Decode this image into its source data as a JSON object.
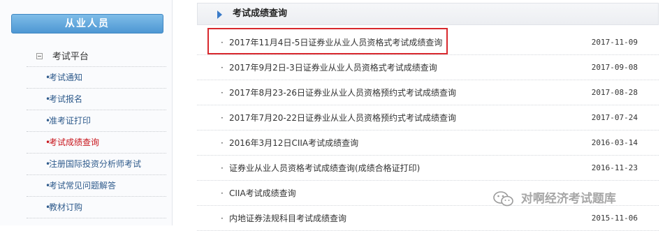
{
  "sidebar": {
    "header": "从业人员",
    "group_label": "考试平台",
    "items": [
      {
        "label": "考试通知",
        "active": false
      },
      {
        "label": "考试报名",
        "active": false
      },
      {
        "label": "准考证打印",
        "active": false
      },
      {
        "label": "考试成绩查询",
        "active": true
      },
      {
        "label": "注册国际投资分析师考试",
        "active": false
      },
      {
        "label": "考试常见问题解答",
        "active": false
      },
      {
        "label": "教材订购",
        "active": false
      }
    ]
  },
  "main": {
    "title": "考试成绩查询",
    "results": [
      {
        "title": "2017年11月4日-5日证券业从业人员资格式考试成绩查询",
        "date": "2017-11-09",
        "highlighted": true
      },
      {
        "title": "2017年9月2日-3日证券业从业人员资格式考试成绩查询",
        "date": "2017-09-08",
        "highlighted": false
      },
      {
        "title": "2017年8月23-26日证券业从业人员资格预约式考试成绩查询",
        "date": "2017-08-28",
        "highlighted": false
      },
      {
        "title": "2017年7月20-22日证券业从业人员资格预约式考试成绩查询",
        "date": "2017-07-24",
        "highlighted": false
      },
      {
        "title": "2016年3月12日CIIA考试成绩查询",
        "date": "2016-03-14",
        "highlighted": false
      },
      {
        "title": "证券业从业人员资格考试成绩查询(成绩合格证打印)",
        "date": "2016-11-23",
        "highlighted": false
      },
      {
        "title": "CIIA考试成绩查询",
        "date": "",
        "highlighted": false
      },
      {
        "title": "内地证券法规科目考试成绩查询",
        "date": "2015-11-06",
        "highlighted": false
      }
    ]
  },
  "watermark": {
    "text": "对啊经济考试题库",
    "icon": "wechat-icon"
  },
  "colors": {
    "active": "#c8161d",
    "link": "#2f5b8c",
    "highlight_border": "#d8282d",
    "header_blue": "#4d97d3"
  }
}
